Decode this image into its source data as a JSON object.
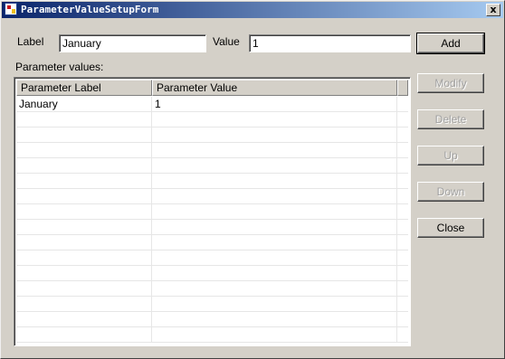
{
  "window": {
    "title": "ParameterValueSetupForm",
    "close_glyph": "x"
  },
  "form": {
    "label_caption": "Label",
    "label_value": "January",
    "value_caption": "Value",
    "value_value": "1",
    "list_caption": "Parameter values:"
  },
  "buttons": {
    "add": "Add",
    "modify": "Modify",
    "delete": "Delete",
    "up": "Up",
    "down": "Down",
    "close": "Close"
  },
  "grid": {
    "columns": [
      "Parameter Label",
      "Parameter Value",
      ""
    ],
    "rows": [
      [
        "January",
        "1"
      ],
      [
        "",
        ""
      ],
      [
        "",
        ""
      ],
      [
        "",
        ""
      ],
      [
        "",
        ""
      ],
      [
        "",
        ""
      ],
      [
        "",
        ""
      ],
      [
        "",
        ""
      ],
      [
        "",
        ""
      ],
      [
        "",
        ""
      ],
      [
        "",
        ""
      ],
      [
        "",
        ""
      ],
      [
        "",
        ""
      ],
      [
        "",
        ""
      ],
      [
        "",
        ""
      ],
      [
        "",
        ""
      ]
    ]
  }
}
